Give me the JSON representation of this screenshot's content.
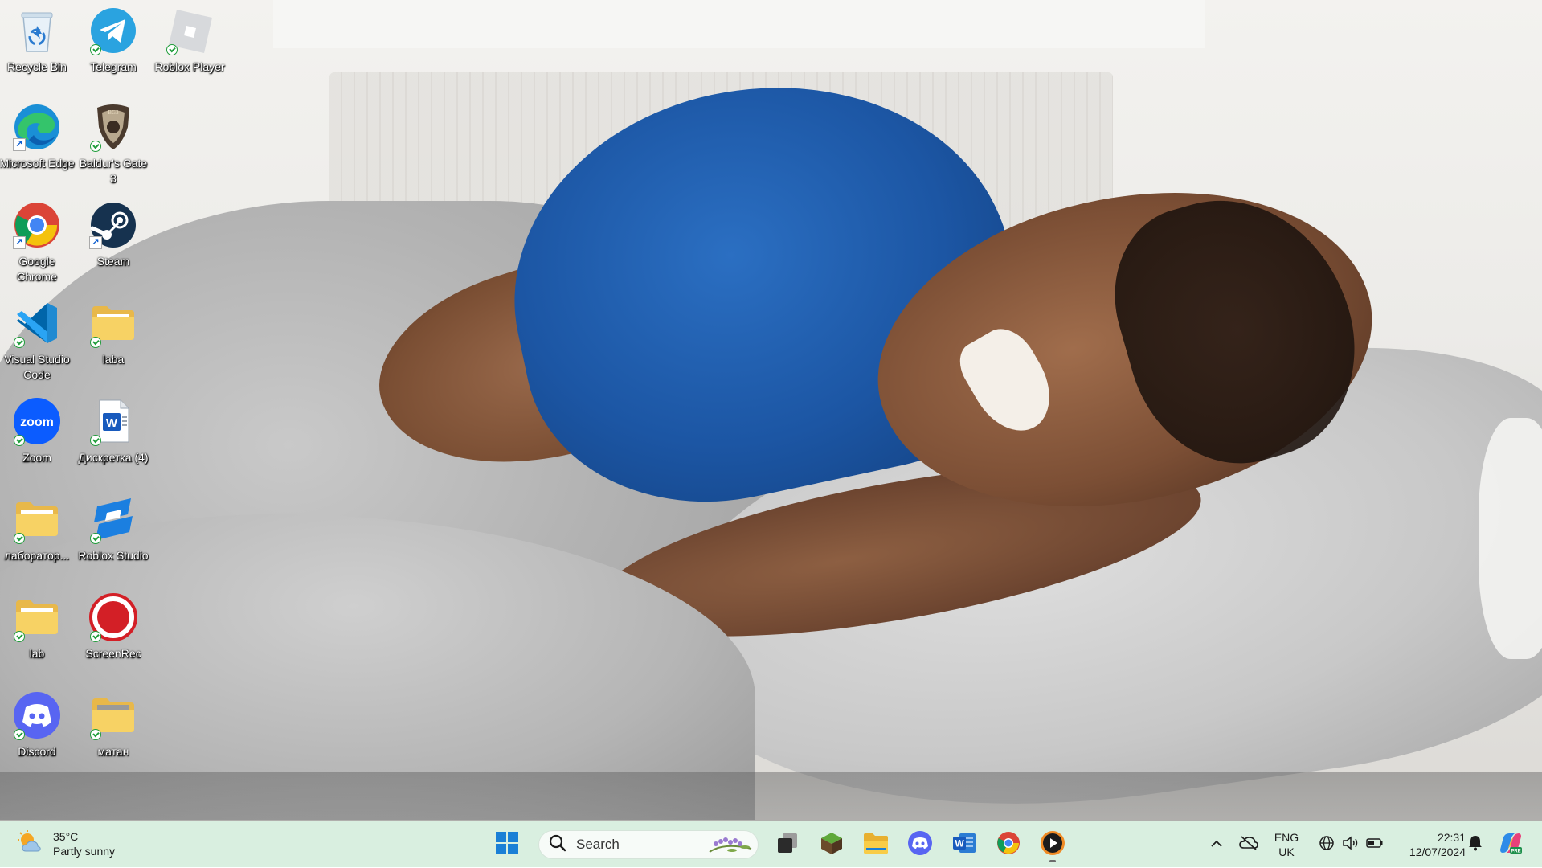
{
  "desktop": {
    "icons": [
      {
        "label": "Recycle Bin"
      },
      {
        "label": "Telegram"
      },
      {
        "label": "Roblox Player"
      },
      {
        "label": "Microsoft Edge"
      },
      {
        "label": "Baldur's Gate 3"
      },
      {
        "label": "Google Chrome"
      },
      {
        "label": "Steam"
      },
      {
        "label": "Visual Studio Code"
      },
      {
        "label": "laba"
      },
      {
        "label": "Zoom"
      },
      {
        "label": "Дискретка (4)"
      },
      {
        "label": "лаборатор..."
      },
      {
        "label": "Roblox Studio"
      },
      {
        "label": "lab"
      },
      {
        "label": "ScreenRec"
      },
      {
        "label": "Discord"
      },
      {
        "label": "матан"
      }
    ],
    "zoom_logo_text": "zoom"
  },
  "taskbar": {
    "weather": {
      "temp": "35°C",
      "condition": "Partly sunny"
    },
    "search_placeholder": "Search",
    "pinned_apps": [
      "start-icon",
      "task-view-icon",
      "minecraft-icon",
      "file-explorer-icon",
      "discord-icon",
      "word-icon",
      "chrome-icon",
      "media-player-icon"
    ],
    "tray": {
      "lang_line1": "ENG",
      "lang_line2": "UK",
      "time": "22:31",
      "date": "12/07/2024"
    },
    "colors": {
      "taskbar_bg": "#d9efe0",
      "accent": "#0f6cbd"
    }
  }
}
